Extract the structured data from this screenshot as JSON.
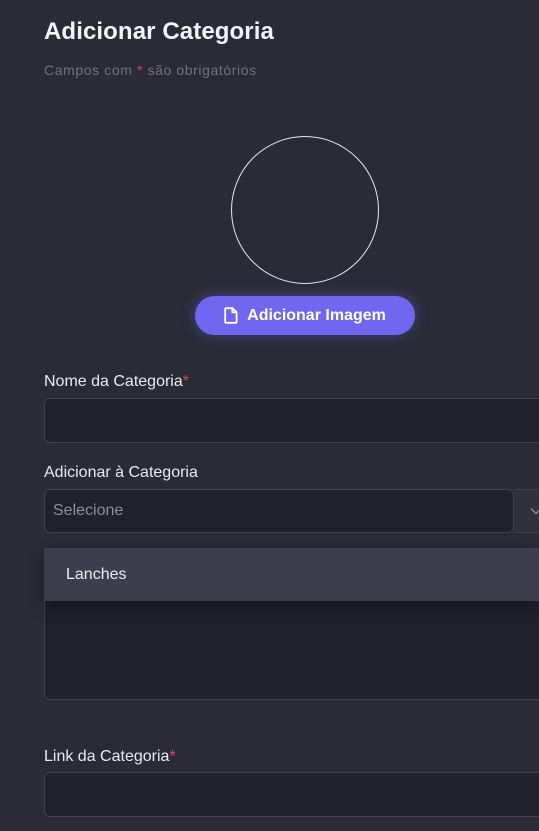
{
  "form": {
    "title": "Adicionar Categoria",
    "subtitle_prefix": "Campos com ",
    "required_mark": "*",
    "subtitle_suffix": " são obrigatórios",
    "image_button_label": "Adicionar Imagem",
    "name_label": "Nome da Categoria",
    "name_value": "",
    "parent_label": "Adicionar à Categoria",
    "parent_placeholder": "Selecione",
    "parent_options": [
      "Lanches"
    ],
    "description_value": "",
    "link_label": "Link da Categoria",
    "link_value": ""
  },
  "colors": {
    "background": "#292b36",
    "accent": "#7166f0",
    "required": "#e64343",
    "field_bg": "#20212a"
  }
}
